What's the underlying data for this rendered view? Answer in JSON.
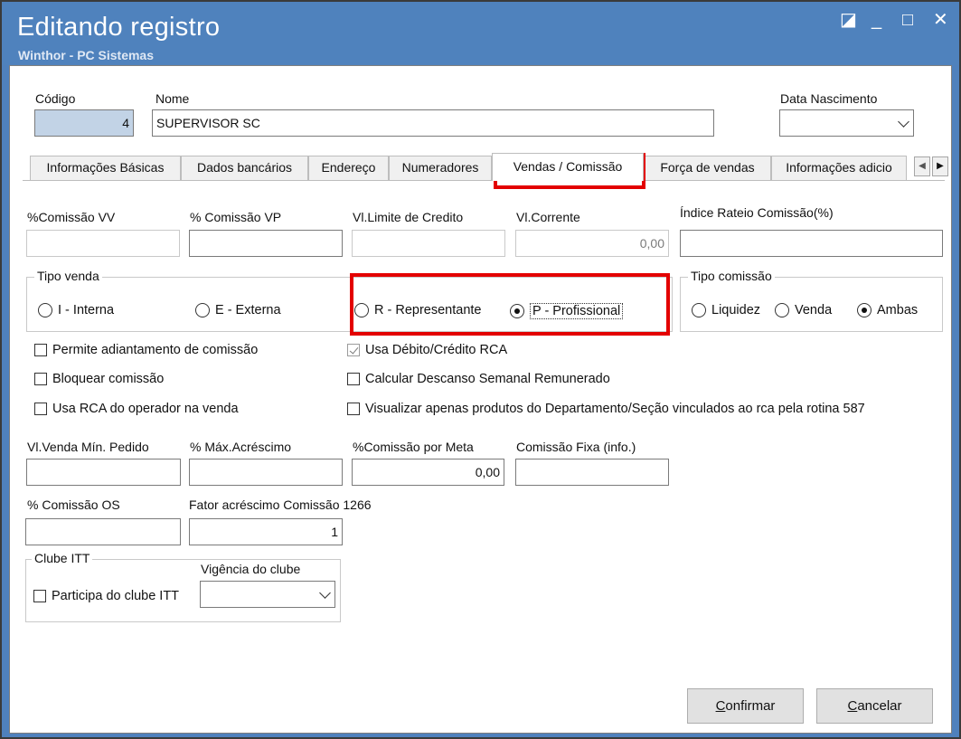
{
  "window": {
    "title": "Editando registro",
    "subtitle": "Winthor - PC Sistemas",
    "controls": {
      "restore": "◪",
      "minimize": "_",
      "maximize": "□",
      "close": "✕"
    }
  },
  "header": {
    "codigo_label": "Código",
    "codigo_value": "4",
    "nome_label": "Nome",
    "nome_value": "SUPERVISOR SC",
    "data_nasc_label": "Data Nascimento",
    "data_nasc_value": ""
  },
  "tabs": [
    {
      "label": "Informações Básicas"
    },
    {
      "label": "Dados bancários"
    },
    {
      "label": "Endereço"
    },
    {
      "label": "Numeradores"
    },
    {
      "label": "Vendas  / Comissão",
      "active": true
    },
    {
      "label": "Força de vendas"
    },
    {
      "label": "Informações adicio"
    }
  ],
  "tab_scroll": {
    "left": "◀",
    "right": "▶"
  },
  "fields_row1": {
    "comissao_vv_label": "%Comissão VV",
    "comissao_vv_value": "",
    "comissao_vp_label": "% Comissão VP",
    "comissao_vp_value": "",
    "limite_credito_label": "Vl.Limite de Credito",
    "limite_credito_value": "",
    "corrente_label": "Vl.Corrente",
    "corrente_value": "0,00",
    "indice_rateio_label": "Índice Rateio Comissão(%)",
    "indice_rateio_value": ""
  },
  "tipo_venda": {
    "title": "Tipo venda",
    "options": [
      {
        "label": "I - Interna",
        "selected": false
      },
      {
        "label": "E - Externa",
        "selected": false
      },
      {
        "label": "R - Representante",
        "selected": false
      },
      {
        "label": "P - Profissional",
        "selected": true
      }
    ]
  },
  "tipo_comissao": {
    "title": "Tipo comissão",
    "options": [
      {
        "label": "Liquidez",
        "selected": false
      },
      {
        "label": "Venda",
        "selected": false
      },
      {
        "label": "Ambas",
        "selected": true
      }
    ]
  },
  "checkboxes": {
    "permite_adiantamento": "Permite adiantamento de comissão",
    "bloquear_comissao": "Bloquear comissão",
    "usa_rca_operador": "Usa RCA do operador na venda",
    "usa_debito_credito": "Usa Débito/Crédito RCA",
    "calcular_dsr": "Calcular Descanso Semanal Remunerado",
    "visualizar_produtos": "Visualizar apenas produtos do Departamento/Seção vinculados ao rca pela rotina 587"
  },
  "fields_row2": {
    "venda_min_label": "Vl.Venda Mín. Pedido",
    "venda_min_value": "",
    "max_acrescimo_label": "% Máx.Acréscimo",
    "max_acrescimo_value": "",
    "comissao_meta_label": "%Comissão por Meta",
    "comissao_meta_value": "0,00",
    "comissao_fixa_label": "Comissão Fixa (info.)",
    "comissao_fixa_value": ""
  },
  "fields_row3": {
    "comissao_os_label": "% Comissão OS",
    "comissao_os_value": "",
    "fator_acrescimo_label": "Fator acréscimo Comissão 1266",
    "fator_acrescimo_value": "1"
  },
  "clube": {
    "title": "Clube ITT",
    "vigencia_label": "Vigência do clube",
    "vigencia_value": "",
    "participa_label": "Participa do clube ITT"
  },
  "buttons": {
    "confirmar_first": "C",
    "confirmar_rest": "onfirmar",
    "cancelar_first": "C",
    "cancelar_rest": "ancelar"
  },
  "colors": {
    "titlebar": "#4f82bd",
    "highlight": "#e30000",
    "code_field": "#c2d3e6"
  }
}
